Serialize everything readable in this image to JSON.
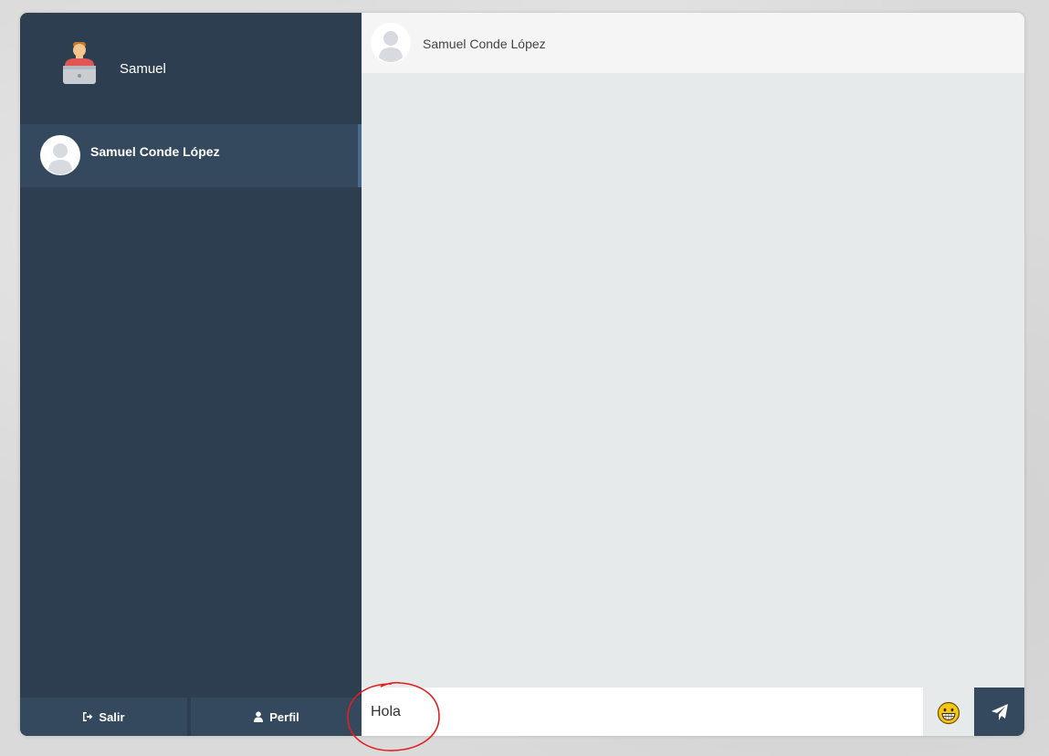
{
  "user": {
    "name": "Samuel",
    "avatar_icon": "user-laptop-icon"
  },
  "contacts": [
    {
      "name": "Samuel Conde López",
      "avatar_icon": "default-avatar-icon",
      "active": true
    }
  ],
  "sidebar_footer": {
    "logout_label": "Salir",
    "logout_icon": "sign-out-icon",
    "profile_label": "Perfil",
    "profile_icon": "user-icon"
  },
  "chat": {
    "header_name": "Samuel Conde López",
    "message_input_value": "Hola",
    "emoji_icon": "grinning-face-icon",
    "send_icon": "paper-plane-icon"
  },
  "colors": {
    "sidebar_bg": "#2d3e50",
    "sidebar_item_bg": "#34495e",
    "chat_bg": "#e6eaea",
    "header_bg": "#f5f5f5",
    "annotation": "#e02020"
  }
}
